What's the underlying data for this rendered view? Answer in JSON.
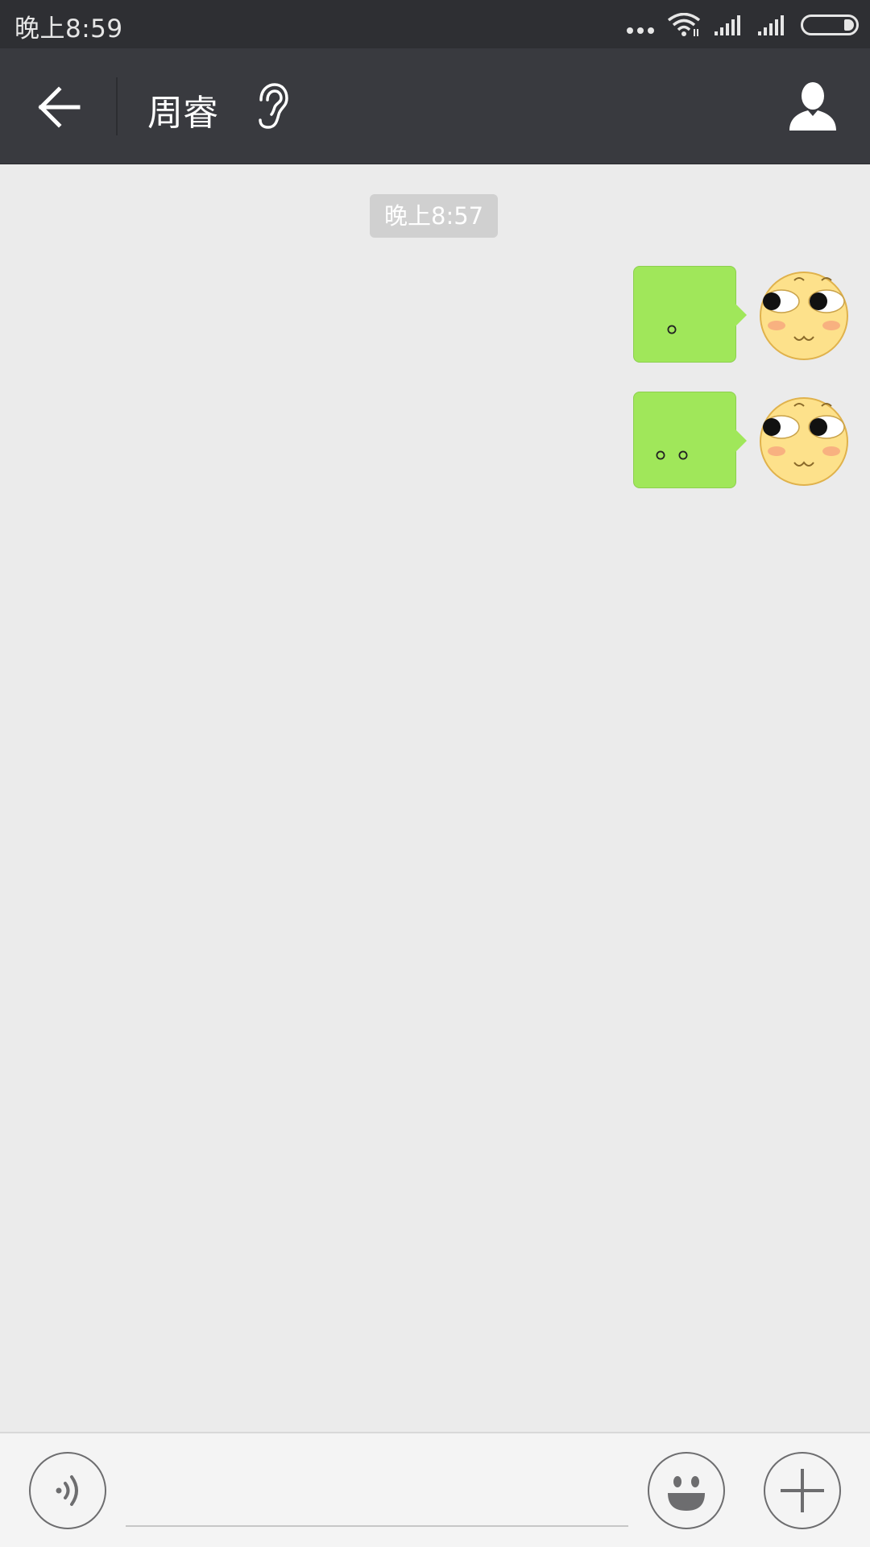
{
  "status_bar": {
    "time": "晚上8:59",
    "icons": [
      "more-dots-icon",
      "wifi-icon",
      "signal-icon",
      "signal-icon",
      "battery-icon"
    ]
  },
  "nav": {
    "title": "周睿",
    "icons": {
      "back": "arrow-left-icon",
      "mode": "ear-icon",
      "profile": "person-icon"
    }
  },
  "chat": {
    "timestamp": "晚上8:57",
    "messages": [
      {
        "sender": "me",
        "text": "。"
      },
      {
        "sender": "me",
        "text": "。。"
      }
    ]
  },
  "input_bar": {
    "value": "",
    "placeholder": "",
    "icons": [
      "voice-icon",
      "emoji-icon",
      "plus-icon"
    ]
  },
  "colors": {
    "status_bar_bg": "#2e2f33",
    "nav_bg": "#393a3f",
    "chat_bg": "#ebebeb",
    "bubble_green": "#a0e75a",
    "timestamp_bg": "#d0d0d0"
  }
}
